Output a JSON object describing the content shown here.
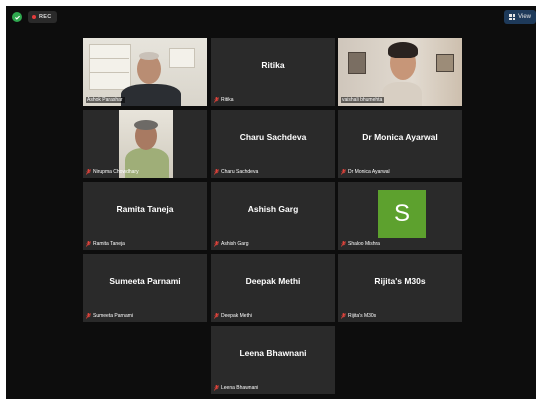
{
  "recording": {
    "label": "REC"
  },
  "view_button": {
    "label": "View"
  },
  "participants": [
    {
      "display_name": "Ashok Parashar",
      "label": "Ashok Parashar"
    },
    {
      "display_name": "Ritika",
      "label": "Ritika"
    },
    {
      "display_name": "vaishali bhumehta",
      "label": "vaishali bhumehta"
    },
    {
      "display_name": "Nirupma Chowdhary",
      "label": "Nirupma Chowdhary"
    },
    {
      "display_name": "Charu Sachdeva",
      "label": "Charu Sachdeva"
    },
    {
      "display_name": "Dr Monica Ayarwal",
      "label": "Dr Monica Ayarwal"
    },
    {
      "display_name": "Ramita Taneja",
      "label": "Ramita Taneja"
    },
    {
      "display_name": "Ashish Garg",
      "label": "Ashish Garg"
    },
    {
      "display_name": "Shaloo Mishra",
      "label": "Shaloo Mishra",
      "avatar_letter": "S"
    },
    {
      "display_name": "Sumeeta Parnami",
      "label": "Sumeeta Parnami"
    },
    {
      "display_name": "Deepak Methi",
      "label": "Deepak Methi"
    },
    {
      "display_name": "Rijita's M30s",
      "label": "Rijita's M30s"
    },
    {
      "display_name": "Leena Bhawnani",
      "label": "Leena Bhawnani"
    }
  ],
  "colors": {
    "background": "#0d0d0d",
    "tile": "#2a2a2a",
    "active_speaker_border": "#8fd14f",
    "muted_mic": "#e0433b",
    "avatar": "#5da12e",
    "security": "#2fa84f"
  }
}
